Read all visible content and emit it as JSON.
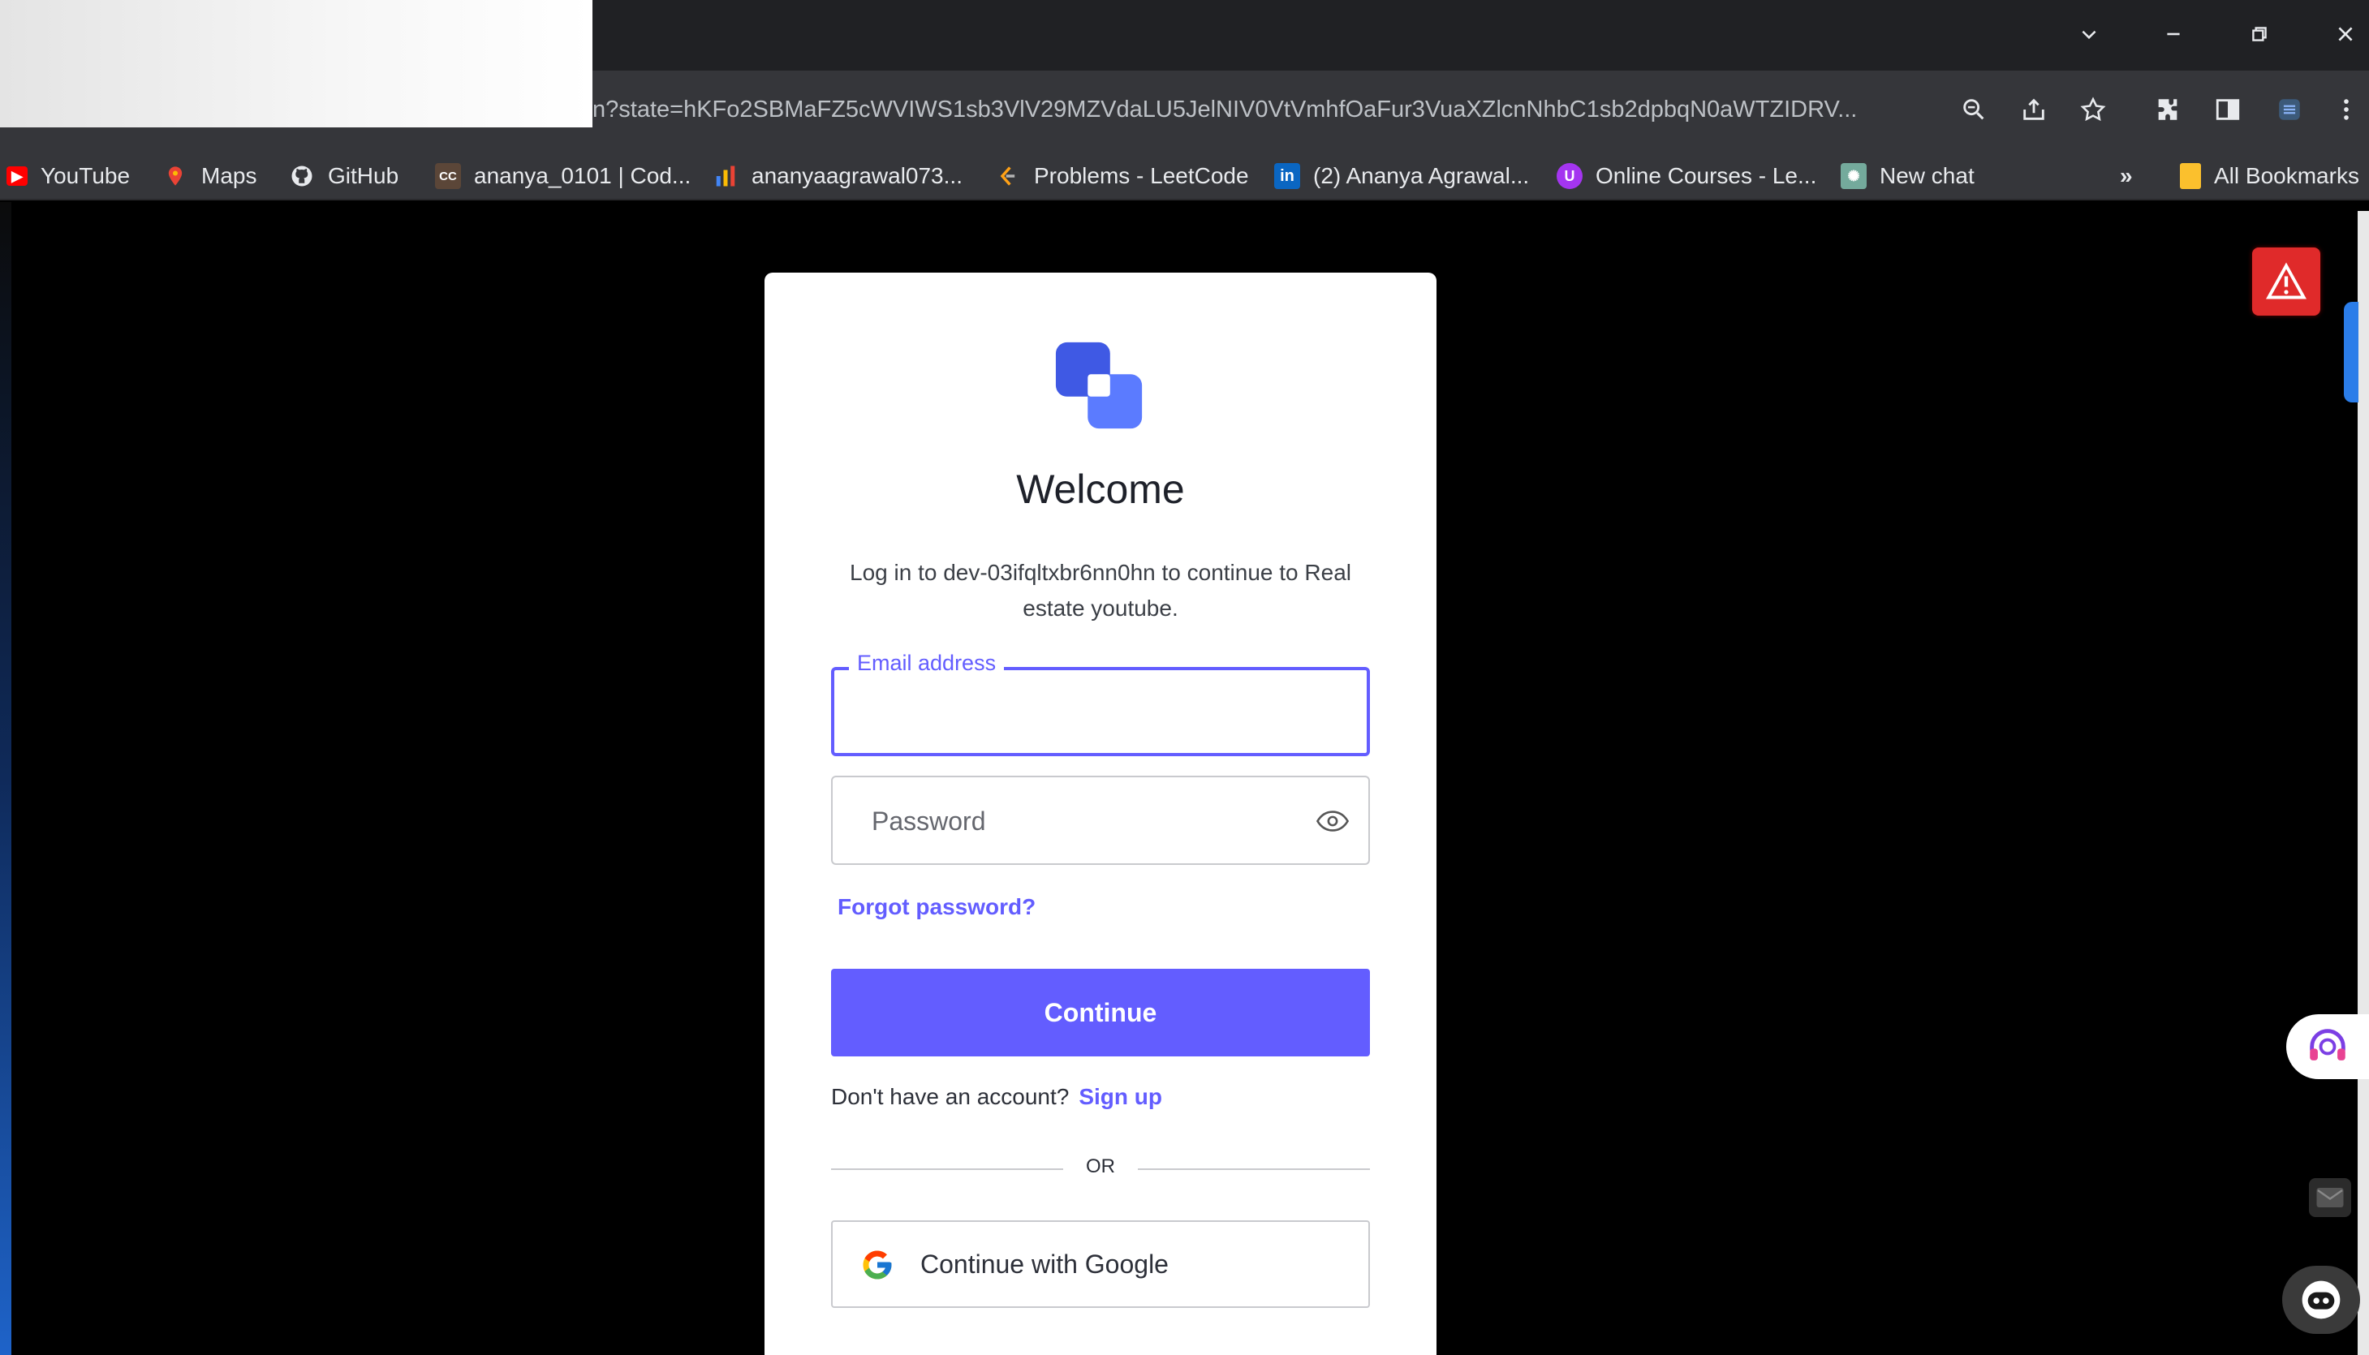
{
  "browser": {
    "url": "n?state=hKFo2SBMaFZ5cWVIWS1sb3VlV29MZVdaLU5JelNIV0VtVmhfOaFur3VuaXZlcnNhbC1sb2dpbqN0aWTZIDRV...",
    "bookmarks": [
      {
        "label": "YouTube",
        "icon": "youtube-icon",
        "color": "#ff0000"
      },
      {
        "label": "Maps",
        "icon": "maps-icon",
        "color": "#34a853"
      },
      {
        "label": "GitHub",
        "icon": "github-icon",
        "color": "#ffffff"
      },
      {
        "label": "ananya_0101 | Cod...",
        "icon": "codechef-icon",
        "color": "#5b4638"
      },
      {
        "label": "ananyaagrawal073...",
        "icon": "chart-icon",
        "color": "#f9a825"
      },
      {
        "label": "Problems - LeetCode",
        "icon": "leetcode-icon",
        "color": "#ffa116"
      },
      {
        "label": "(2) Ananya Agrawal...",
        "icon": "linkedin-icon",
        "color": "#0a66c2"
      },
      {
        "label": "Online Courses - Le...",
        "icon": "udemy-icon",
        "color": "#a435f0"
      },
      {
        "label": "New chat",
        "icon": "chatgpt-icon",
        "color": "#74aa9c"
      }
    ],
    "overflow_label": "»",
    "all_bookmarks_label": "All Bookmarks"
  },
  "login": {
    "title": "Welcome",
    "subtitle": "Log in to dev-03ifqltxbr6nn0hn to continue to Real estate youtube.",
    "email_label": "Email address",
    "email_value": "",
    "password_placeholder": "Password",
    "forgot_password": "Forgot password?",
    "continue_label": "Continue",
    "no_account_text": "Don't have an account?",
    "signup_label": "Sign up",
    "or_text": "OR",
    "google_label": "Continue with Google"
  },
  "colors": {
    "accent": "#635dff",
    "alert": "#e02a2a",
    "logo_blue": "#3f59e4"
  }
}
